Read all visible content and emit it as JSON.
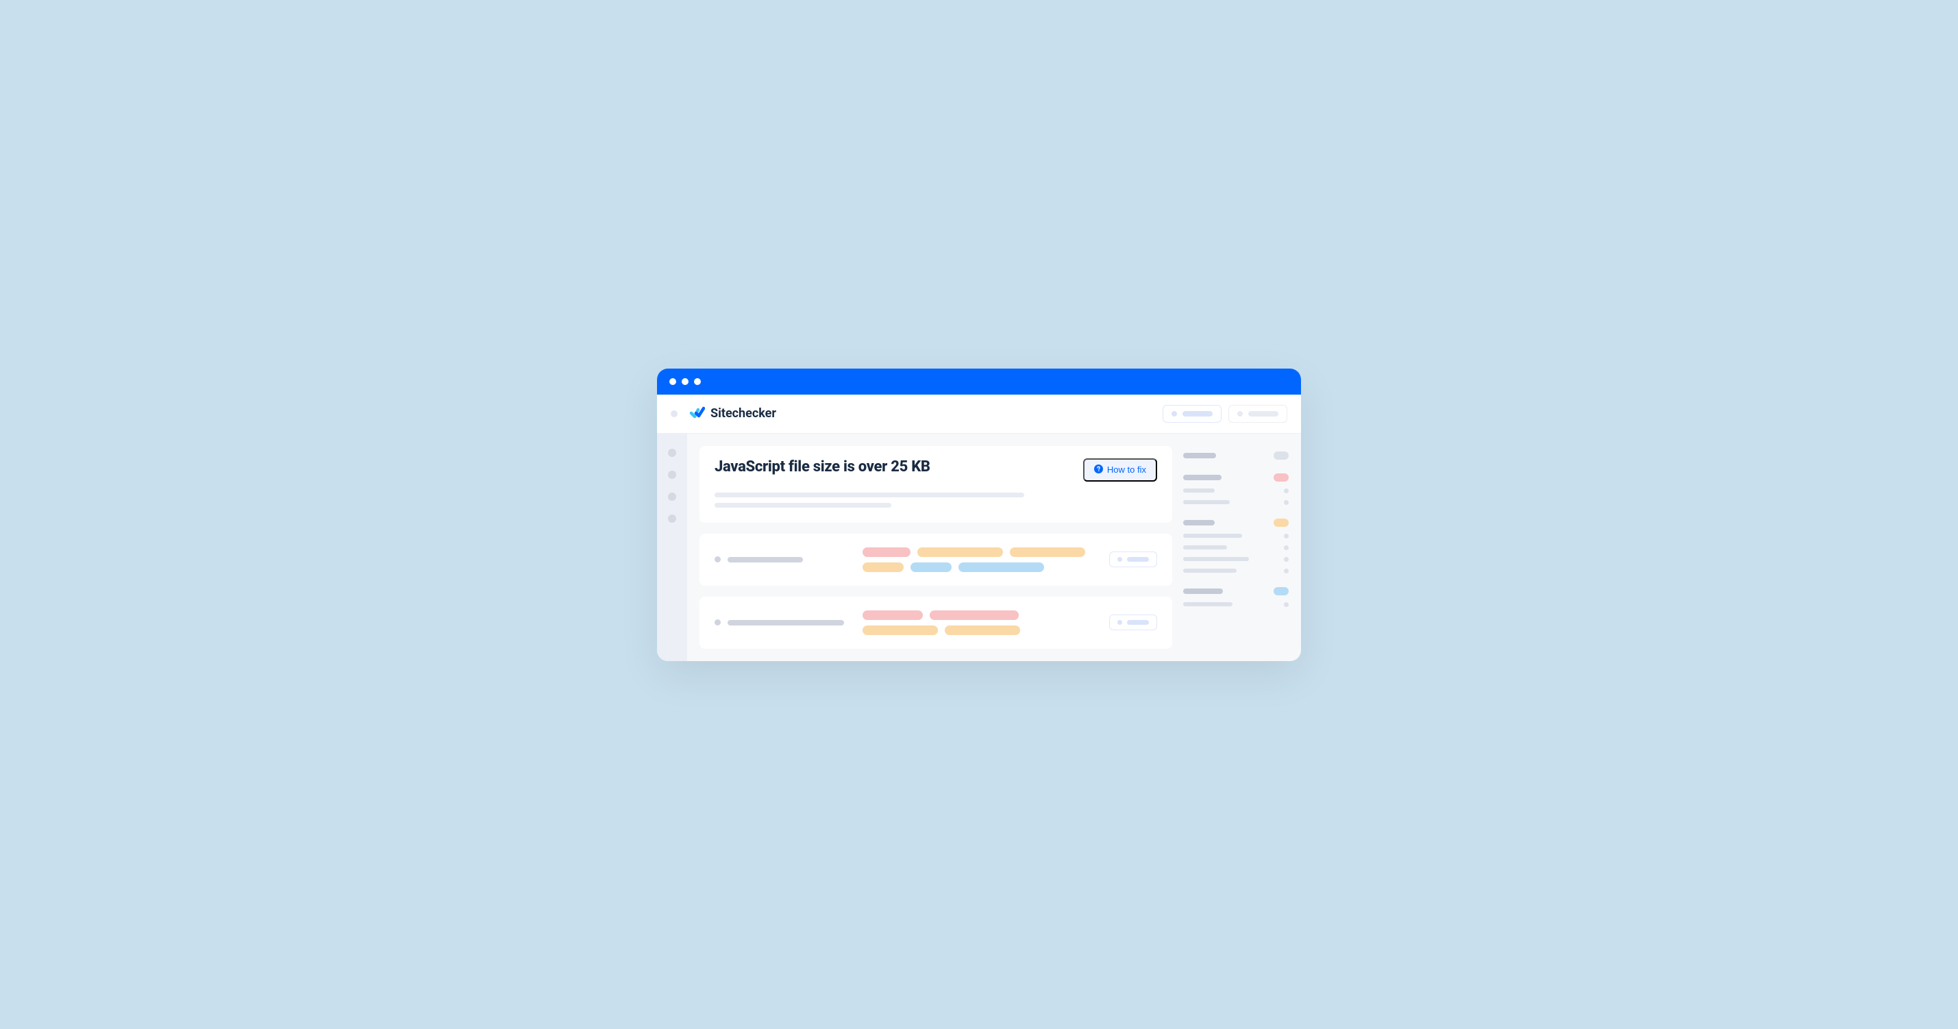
{
  "app": {
    "name": "Sitechecker"
  },
  "issue": {
    "title": "JavaScript file size is over 25 KB",
    "how_to_fix": "How to fix"
  }
}
